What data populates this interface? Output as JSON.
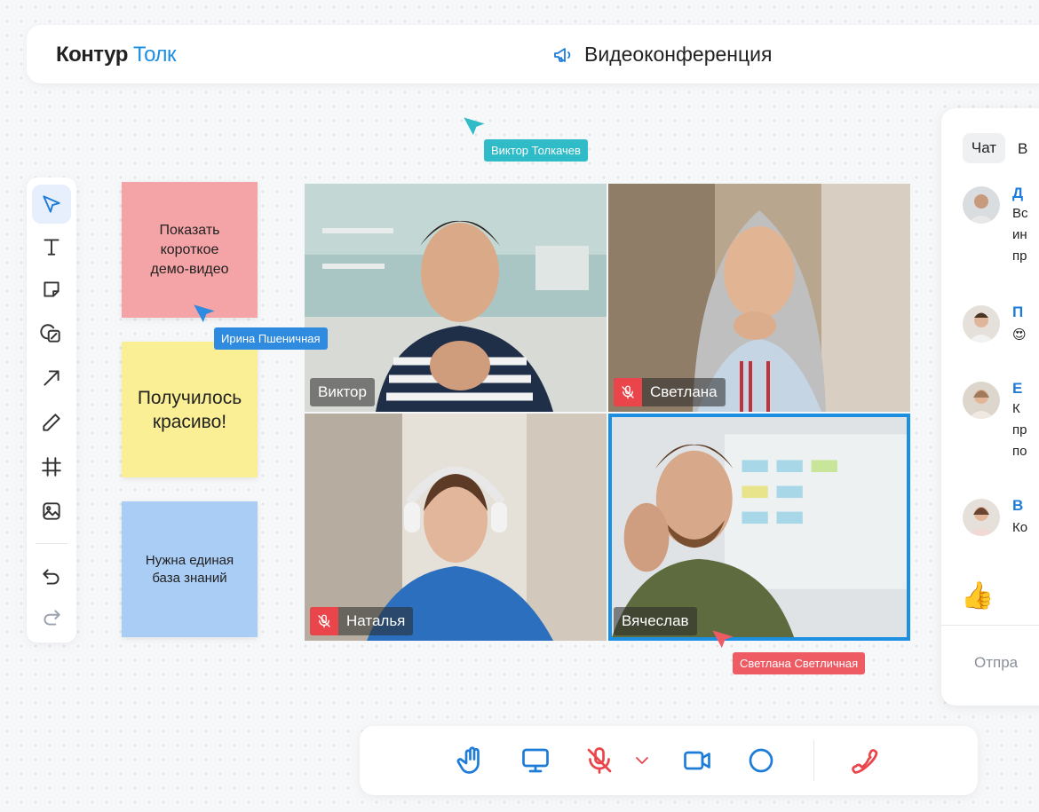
{
  "app": {
    "brand_primary": "Контур",
    "brand_secondary": "Толк",
    "meeting_title": "Видеоконференция",
    "accent": "#1d8fe1"
  },
  "toolbar": {
    "tools": [
      {
        "name": "select-tool",
        "icon": "cursor-arrow-icon",
        "active": true
      },
      {
        "name": "text-tool",
        "icon": "text-icon"
      },
      {
        "name": "sticky-note-tool",
        "icon": "sticky-note-icon"
      },
      {
        "name": "shapes-tool",
        "icon": "shapes-icon"
      },
      {
        "name": "arrow-tool",
        "icon": "arrow-icon"
      },
      {
        "name": "pencil-tool",
        "icon": "pencil-icon"
      },
      {
        "name": "frame-tool",
        "icon": "frame-icon"
      },
      {
        "name": "image-tool",
        "icon": "image-icon"
      },
      {
        "name": "undo-tool",
        "icon": "undo-icon"
      },
      {
        "name": "redo-tool",
        "icon": "redo-icon",
        "disabled": true
      }
    ]
  },
  "stickies": [
    {
      "lines": [
        "Показать",
        "короткое",
        "демо-видео"
      ],
      "color": "#f4a3a6"
    },
    {
      "lines": [
        "Получилось",
        "красиво!"
      ],
      "color": "#fbef96"
    },
    {
      "lines": [
        "Нужна единая",
        "база знаний"
      ],
      "color": "#aacdf6"
    }
  ],
  "cursors": [
    {
      "label": "Виктор Толкачев",
      "color": "#2fbcc8"
    },
    {
      "label": "Ирина Пшеничная",
      "color": "#2f8be0"
    },
    {
      "label": "Светлана Светличная",
      "color": "#ee5b63"
    }
  ],
  "participants": [
    {
      "name": "Виктор",
      "muted": false
    },
    {
      "name": "Светлана",
      "muted": true
    },
    {
      "name": "Наталья",
      "muted": true
    },
    {
      "name": "Вячеслав",
      "muted": false,
      "speaking": true
    }
  ],
  "chat": {
    "tabs": [
      "Чат",
      "В"
    ],
    "messages": [
      {
        "author": "Д",
        "lines": [
          "Вс",
          "ин",
          "пр"
        ]
      },
      {
        "author": "П",
        "lines": [
          "😍"
        ]
      },
      {
        "author": "Е",
        "lines": [
          "К",
          "пр",
          "по"
        ]
      },
      {
        "author": "В",
        "lines": [
          "Ко"
        ]
      }
    ],
    "reaction": "👍",
    "input_placeholder": "Отпра"
  },
  "controls": [
    {
      "name": "raise-hand-button",
      "icon": "hand-icon"
    },
    {
      "name": "screen-share-button",
      "icon": "monitor-icon"
    },
    {
      "name": "microphone-button",
      "icon": "mic-off-icon",
      "color": "#e9454a"
    },
    {
      "name": "mic-options-button",
      "icon": "chevron-down-icon",
      "color": "#e9454a"
    },
    {
      "name": "camera-button",
      "icon": "video-camera-icon"
    },
    {
      "name": "record-button",
      "icon": "circle-icon"
    },
    {
      "name": "hang-up-button",
      "icon": "phone-icon",
      "color": "#e9454a"
    }
  ]
}
